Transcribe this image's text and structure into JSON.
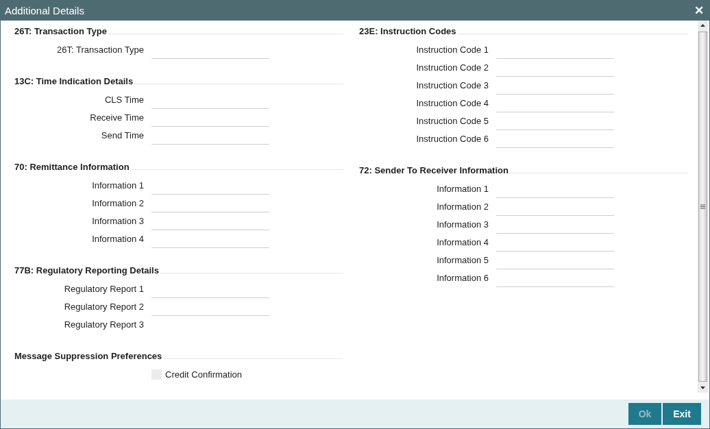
{
  "window": {
    "title": "Additional Details",
    "close": "✕"
  },
  "columns": [
    {
      "sections": [
        {
          "heading": "26T: Transaction Type",
          "fields": [
            {
              "kind": "field",
              "label": "26T: Transaction Type"
            }
          ]
        },
        {
          "heading": "13C: Time Indication Details",
          "fields": [
            {
              "kind": "field",
              "label": "CLS Time"
            },
            {
              "kind": "field",
              "label": "Receive Time"
            },
            {
              "kind": "field",
              "label": "Send Time"
            }
          ]
        },
        {
          "heading": "70: Remittance Information",
          "fields": [
            {
              "kind": "field",
              "label": "Information 1"
            },
            {
              "kind": "field",
              "label": "Information 2"
            },
            {
              "kind": "field",
              "label": "Information 3"
            },
            {
              "kind": "field",
              "label": "Information 4"
            }
          ]
        },
        {
          "heading": "77B: Regulatory Reporting Details",
          "fields": [
            {
              "kind": "field",
              "label": "Regulatory Report 1"
            },
            {
              "kind": "field",
              "label": "Regulatory Report 2"
            },
            {
              "kind": "label",
              "label": "Regulatory Report 3"
            }
          ]
        },
        {
          "heading": "Message Suppression Preferences",
          "fields": [
            {
              "kind": "checkbox",
              "label": "Credit Confirmation",
              "checked": false
            }
          ]
        }
      ]
    },
    {
      "sections": [
        {
          "heading": "23E: Instruction Codes",
          "fields": [
            {
              "kind": "field",
              "label": "Instruction Code 1"
            },
            {
              "kind": "field",
              "label": "Instruction Code 2"
            },
            {
              "kind": "field",
              "label": "Instruction Code 3"
            },
            {
              "kind": "field",
              "label": "Instruction Code 4"
            },
            {
              "kind": "field",
              "label": "Instruction Code 5"
            },
            {
              "kind": "field",
              "label": "Instruction Code 6"
            }
          ]
        },
        {
          "heading": "72: Sender To Receiver Information",
          "fields": [
            {
              "kind": "field",
              "label": "Information 1"
            },
            {
              "kind": "field",
              "label": "Information 2"
            },
            {
              "kind": "field",
              "label": "Information 3"
            },
            {
              "kind": "field",
              "label": "Information 4"
            },
            {
              "kind": "field",
              "label": "Information 5"
            },
            {
              "kind": "field",
              "label": "Information 6"
            }
          ]
        }
      ]
    }
  ],
  "buttons": [
    {
      "label": "Ok",
      "disabled": true
    },
    {
      "label": "Exit",
      "disabled": false
    }
  ]
}
